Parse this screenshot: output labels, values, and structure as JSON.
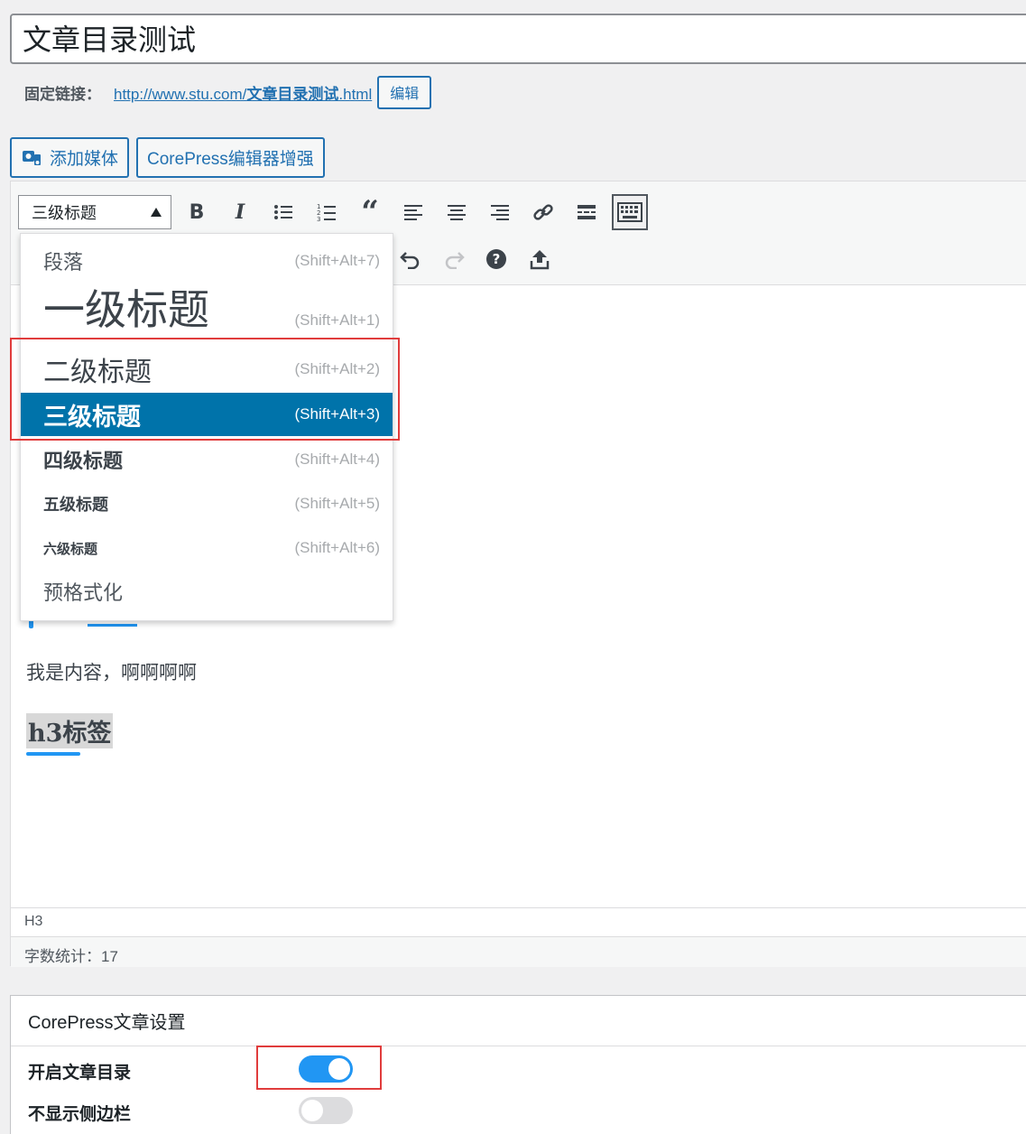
{
  "post": {
    "title": "文章目录测试",
    "permalink_label": "固定链接：",
    "permalink_prefix": "http://www.stu.com/",
    "permalink_slug": "文章目录测试",
    "permalink_suffix": ".html",
    "edit_button": "编辑"
  },
  "media_buttons": {
    "add_media": "添加媒体",
    "corepress_enhance": "CorePress编辑器增强"
  },
  "toolbar": {
    "format_select": "三级标题",
    "icons": [
      "bold-icon",
      "italic-icon",
      "bullet-list-icon",
      "numbered-list-icon",
      "blockquote-icon",
      "align-left-icon",
      "align-center-icon",
      "align-right-icon",
      "link-icon",
      "read-more-icon",
      "toolbar-toggle-icon",
      "undo-icon",
      "redo-icon",
      "help-icon",
      "upload-icon"
    ]
  },
  "format_dropdown": {
    "items": [
      {
        "label": "段落",
        "shortcut": "(Shift+Alt+7)"
      },
      {
        "label": "一级标题",
        "shortcut": "(Shift+Alt+1)"
      },
      {
        "label": "二级标题",
        "shortcut": "(Shift+Alt+2)"
      },
      {
        "label": "三级标题",
        "shortcut": "(Shift+Alt+3)"
      },
      {
        "label": "四级标题",
        "shortcut": "(Shift+Alt+4)"
      },
      {
        "label": "五级标题",
        "shortcut": "(Shift+Alt+5)"
      },
      {
        "label": "六级标题",
        "shortcut": "(Shift+Alt+6)"
      },
      {
        "label": "预格式化",
        "shortcut": ""
      }
    ],
    "selected_index": 3
  },
  "content": {
    "paragraph": "我是内容，啊啊啊啊",
    "h3_text": "h3标签"
  },
  "status": {
    "path": "H3",
    "word_count": "字数统计：17"
  },
  "settings": {
    "title": "CorePress文章设置",
    "rows": [
      {
        "label": "开启文章目录",
        "enabled": true
      },
      {
        "label": "不显示侧边栏",
        "enabled": false
      }
    ]
  },
  "colors": {
    "accent": "#2271b1",
    "selected_bg": "#0073aa",
    "toggle_on": "#2196f3",
    "toggle_off": "#dcdcde",
    "highlight_box": "#e03c3c"
  }
}
